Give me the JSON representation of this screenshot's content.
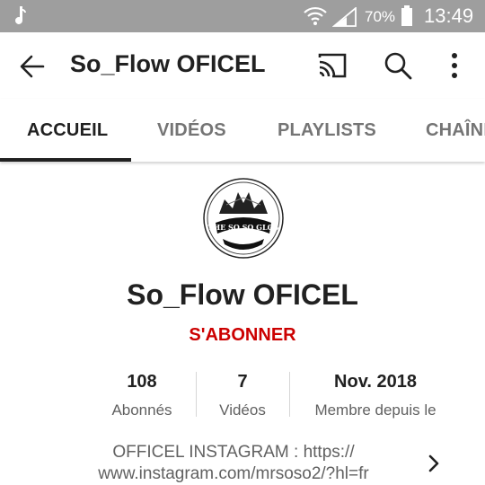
{
  "status_bar": {
    "battery_percent": "70%",
    "time": "13:49",
    "icons": [
      "music-note-icon",
      "wifi-icon",
      "signal-icon",
      "battery-icon"
    ]
  },
  "app_bar": {
    "title": "So_Flow OFICEL",
    "icons": [
      "back-arrow-icon",
      "cast-icon",
      "search-icon",
      "more-vert-icon"
    ]
  },
  "tabs": [
    {
      "label": "ACCUEIL",
      "active": true
    },
    {
      "label": "VIDÉOS",
      "active": false
    },
    {
      "label": "PLAYLISTS",
      "active": false
    },
    {
      "label": "CHAÎNES",
      "active": false
    }
  ],
  "channel": {
    "name": "So_Flow OFICEL",
    "subscribe_label": "S'ABONNER",
    "avatar_text": "THE SO SO GLOS",
    "stats": [
      {
        "value": "108",
        "label": "Abonnés"
      },
      {
        "value": "7",
        "label": "Vidéos"
      },
      {
        "value": "Nov. 2018",
        "label": "Membre depuis le"
      }
    ],
    "description_line1": "OFFICEL INSTAGRAM : https://",
    "description_line2": "www.instagram.com/mrsoso2/?hl=fr"
  },
  "colors": {
    "status_bar_bg": "#9e9e9e",
    "subscribe_red": "#cc0000",
    "active_tab": "#212121",
    "inactive_tab": "#757575"
  }
}
